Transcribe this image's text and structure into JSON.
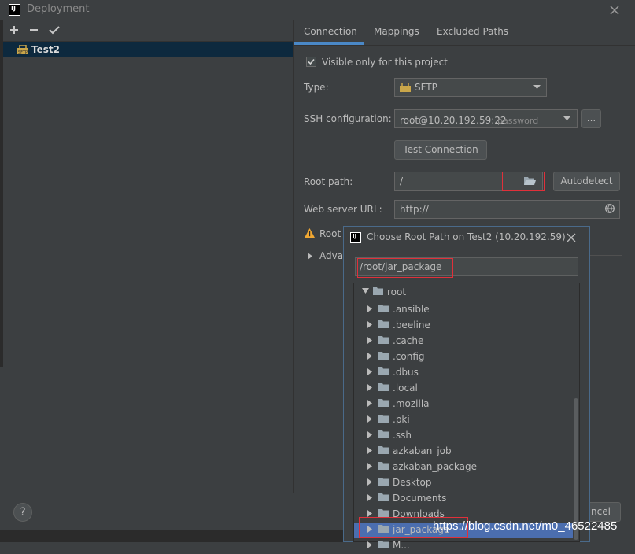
{
  "window": {
    "title": "Deployment",
    "app_icon": "IJ"
  },
  "left": {
    "toolbar": [
      "add-icon",
      "remove-icon",
      "check-icon"
    ],
    "servers": [
      {
        "name": "Test2",
        "icon": "sftp-icon",
        "selected": true
      }
    ]
  },
  "tabs": [
    {
      "label": "Connection",
      "active": true
    },
    {
      "label": "Mappings",
      "active": false
    },
    {
      "label": "Excluded Paths",
      "active": false
    }
  ],
  "form": {
    "visible_only": {
      "label": "Visible only for this project",
      "checked": true
    },
    "type": {
      "label": "Type:",
      "value": "SFTP"
    },
    "ssh": {
      "label": "SSH configuration:",
      "value": "root@10.20.192.59:22",
      "suffix": "password",
      "more": "..."
    },
    "test_connection": "Test Connection",
    "root_path": {
      "label": "Root path:",
      "value": "/"
    },
    "autodetect": "Autodetect",
    "web_url": {
      "label": "Web server URL:",
      "value": "http://"
    },
    "warning_text": "Root",
    "advanced_text": "Adva"
  },
  "bottom": {
    "help": "?",
    "cancel_partial": "ncel"
  },
  "dialog": {
    "icon": "IJ",
    "title": "Choose Root Path on Test2 (10.20.192.59)",
    "path": "/root/jar_package",
    "tree_root": "root",
    "folders": [
      ".ansible",
      ".beeline",
      ".cache",
      ".config",
      ".dbus",
      ".local",
      ".mozilla",
      ".pki",
      ".ssh",
      "azkaban_job",
      "azkaban_package",
      "Desktop",
      "Documents",
      "Downloads",
      "jar_package",
      "M..."
    ],
    "selected_folder": "jar_package"
  },
  "watermark": "https://blog.csdn.net/m0_46522485",
  "colors": {
    "accent": "#4a88c7",
    "selection": "#0d293e",
    "highlight": "#4b6eaf",
    "annotation": "#e0303a",
    "warning": "#f0a732"
  }
}
